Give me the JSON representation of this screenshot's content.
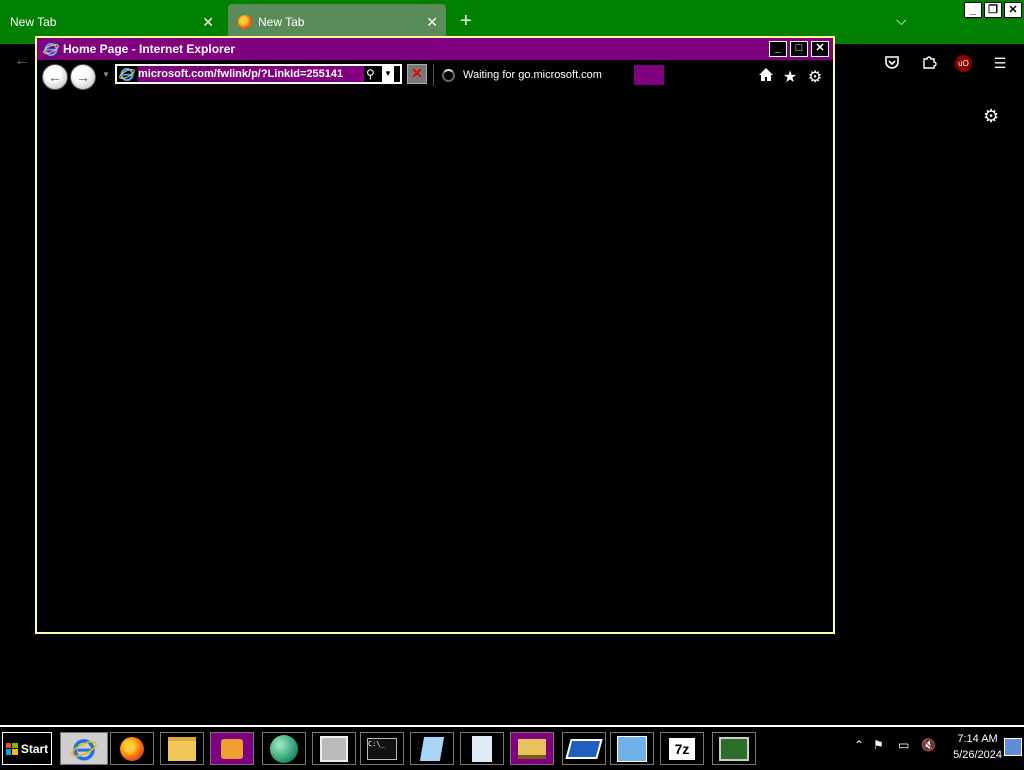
{
  "firefox": {
    "tabs": [
      {
        "label": "New Tab"
      },
      {
        "label": "New Tab"
      }
    ]
  },
  "ie": {
    "title": "Home Page - Internet Explorer",
    "address": "microsoft.com/fwlink/p/?LinkId=255141",
    "tab_label": "Waiting for go.microsoft.com"
  },
  "taskbar": {
    "start_label": "Start",
    "apps": [
      "internet-explorer",
      "firefox",
      "file-explorer",
      "media-player",
      "globe-app",
      "disk-app",
      "command-prompt",
      "notepad",
      "document",
      "stack-app",
      "scanner-app",
      "control-panel",
      "7zip",
      "monitor-app"
    ],
    "time": "7:14 AM",
    "date": "5/26/2024"
  },
  "colors": {
    "ff_tabstrip": "#008000",
    "ie_accent": "#800080",
    "ie_border": "#ffff99"
  }
}
